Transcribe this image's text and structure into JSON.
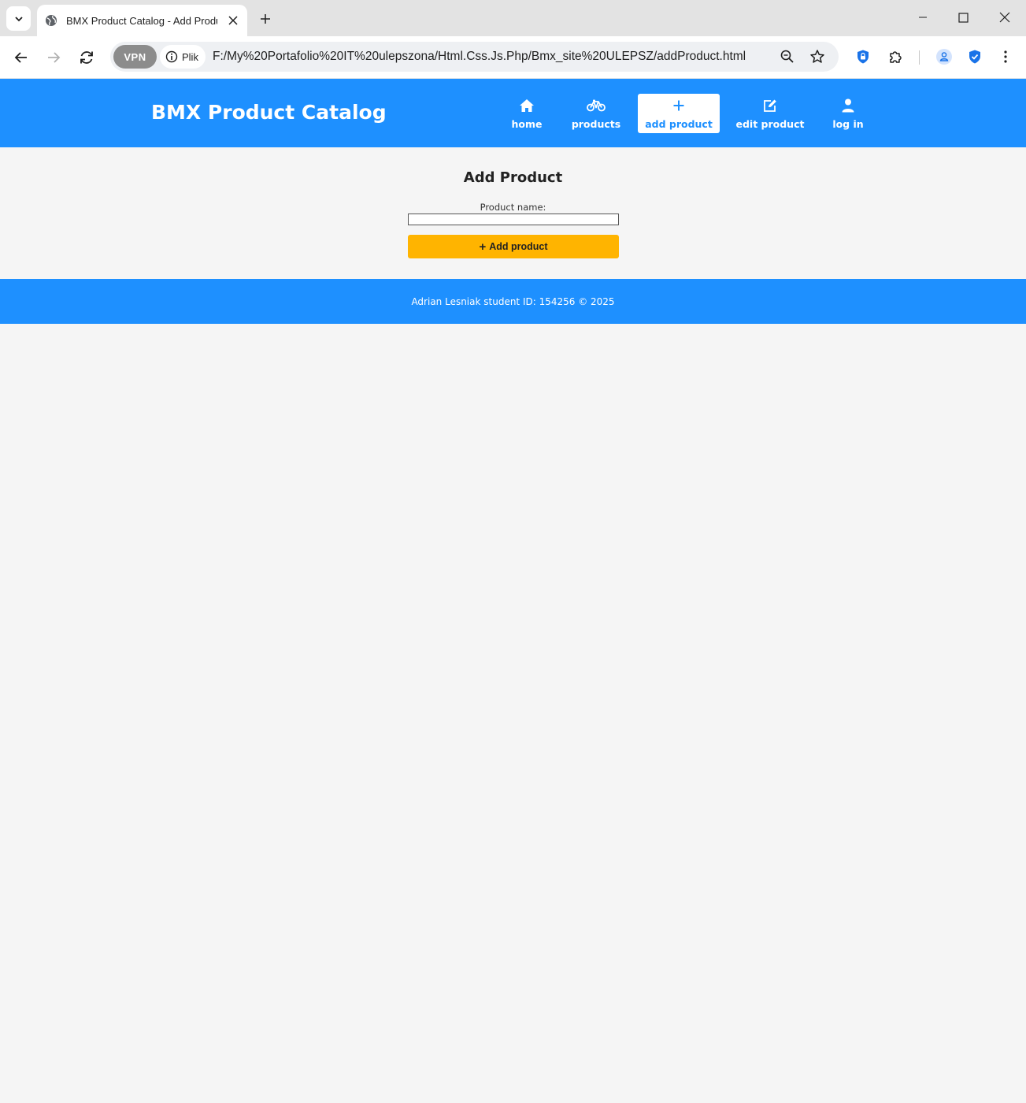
{
  "browser": {
    "tab_title": "BMX Product Catalog - Add Produ",
    "url": "F:/My%20Portafolio%20IT%20ulepszona/Html.Css.Js.Php/Bmx_site%20ULEPSZ/addProduct.html",
    "vpn_label": "VPN",
    "site_chip_label": "Plik"
  },
  "header": {
    "brand": "BMX Product Catalog",
    "nav": [
      {
        "label": "home",
        "icon": "home-icon",
        "active": false
      },
      {
        "label": "products",
        "icon": "bicycle-icon",
        "active": false
      },
      {
        "label": "add product",
        "icon": "plus-icon",
        "active": true
      },
      {
        "label": "edit product",
        "icon": "edit-icon",
        "active": false
      },
      {
        "label": "log in",
        "icon": "user-icon",
        "active": false
      }
    ]
  },
  "main": {
    "heading": "Add Product",
    "product_name_label": "Product name:",
    "product_name_value": "",
    "add_button_label": "Add product"
  },
  "footer": {
    "text": "Adrian Lesniak student ID: 154256 © 2025"
  },
  "colors": {
    "primary": "#1e90ff",
    "button": "#ffb400",
    "background": "#f5f5f5"
  }
}
